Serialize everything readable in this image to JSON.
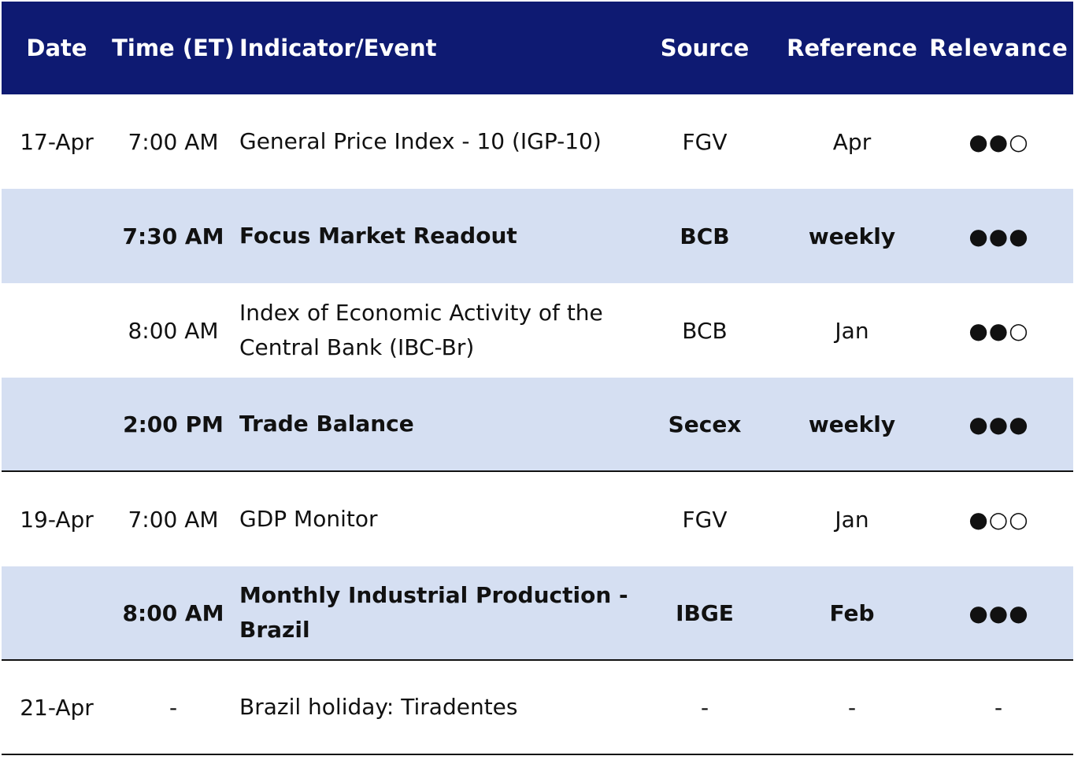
{
  "table": {
    "headers": {
      "date": "Date",
      "time": "Time (ET)",
      "event": "Indicator/Event",
      "source": "Source",
      "reference": "Reference",
      "relevance": "Relevance"
    },
    "rows": [
      {
        "date": "17-Apr",
        "time": "7:00 AM",
        "event": "General Price Index - 10 (IGP-10)",
        "source": "FGV",
        "reference": "Apr",
        "relevance": "●●○"
      },
      {
        "date": "",
        "time": "7:30 AM",
        "event": "Focus Market Readout",
        "source": "BCB",
        "reference": "weekly",
        "relevance": "●●●"
      },
      {
        "date": "",
        "time": "8:00 AM",
        "event": "Index of Economic Activity of the Central Bank (IBC-Br)",
        "source": "BCB",
        "reference": "Jan",
        "relevance": "●●○"
      },
      {
        "date": "",
        "time": "2:00 PM",
        "event": "Trade Balance",
        "source": "Secex",
        "reference": "weekly",
        "relevance": "●●●"
      },
      {
        "date": "19-Apr",
        "time": "7:00 AM",
        "event": "GDP Monitor",
        "source": "FGV",
        "reference": "Jan",
        "relevance": "●○○"
      },
      {
        "date": "",
        "time": "8:00 AM",
        "event": "Monthly Industrial Production - Brazil",
        "source": "IBGE",
        "reference": "Feb",
        "relevance": "●●●"
      },
      {
        "date": "21-Apr",
        "time": "-",
        "event": "Brazil holiday: Tiradentes",
        "source": "-",
        "reference": "-",
        "relevance": "-"
      }
    ]
  },
  "colors": {
    "header_bg": "#0e1a72",
    "header_text": "#ffffff",
    "shaded_row_bg": "#d5dff2",
    "text": "#111111"
  }
}
